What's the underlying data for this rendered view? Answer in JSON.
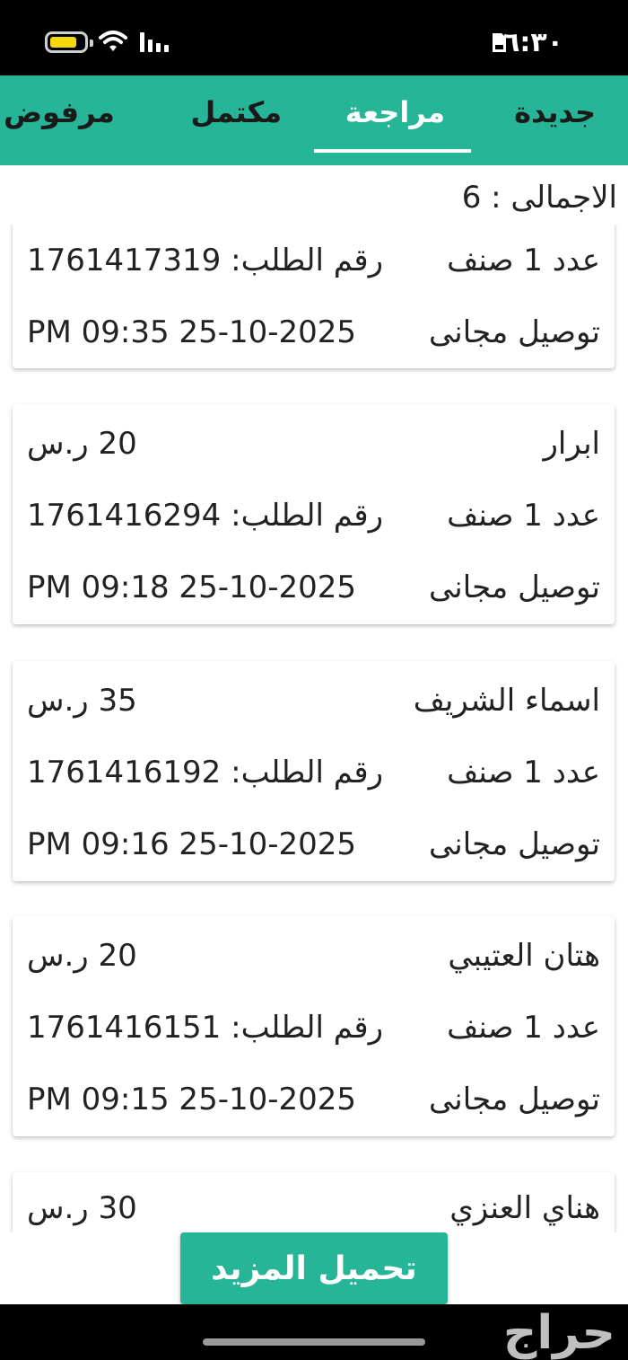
{
  "status_bar": {
    "time": "٦:٣٠",
    "battery_level": 0.8,
    "icons": [
      "battery-icon",
      "wifi-icon",
      "signal-icon",
      "sim-icon"
    ]
  },
  "tabs": [
    {
      "label": "جديدة",
      "active": false
    },
    {
      "label": "مراجعة",
      "active": true
    },
    {
      "label": "مكتمل",
      "active": false
    },
    {
      "label": "مرفوض",
      "active": false
    }
  ],
  "accent_color": "#26b597",
  "total_text": "الاجمالى : 6",
  "orders": [
    {
      "customer": "",
      "price": "",
      "items": "عدد 1 صنف",
      "order_no": "رقم الطلب: 1761417319",
      "delivery": "توصيل مجانى",
      "datetime": "PM 09:35  25-10-2025"
    },
    {
      "customer": "ابرار",
      "price": "20 ر.س",
      "items": "عدد 1 صنف",
      "order_no": "رقم الطلب: 1761416294",
      "delivery": "توصيل مجانى",
      "datetime": "PM 09:18  25-10-2025"
    },
    {
      "customer": "اسماء الشريف",
      "price": "35 ر.س",
      "items": "عدد 1 صنف",
      "order_no": "رقم الطلب: 1761416192",
      "delivery": "توصيل مجانى",
      "datetime": "PM 09:16  25-10-2025"
    },
    {
      "customer": "هتان العتيبي",
      "price": "20 ر.س",
      "items": "عدد 1 صنف",
      "order_no": "رقم الطلب: 1761416151",
      "delivery": "توصيل مجانى",
      "datetime": "PM 09:15  25-10-2025"
    },
    {
      "customer": "هناي العنزي",
      "price": "30 ر.س",
      "items": "",
      "order_no": "",
      "delivery": "",
      "datetime": ""
    }
  ],
  "load_more_label": "تحميل المزيد",
  "watermark": "حراج"
}
